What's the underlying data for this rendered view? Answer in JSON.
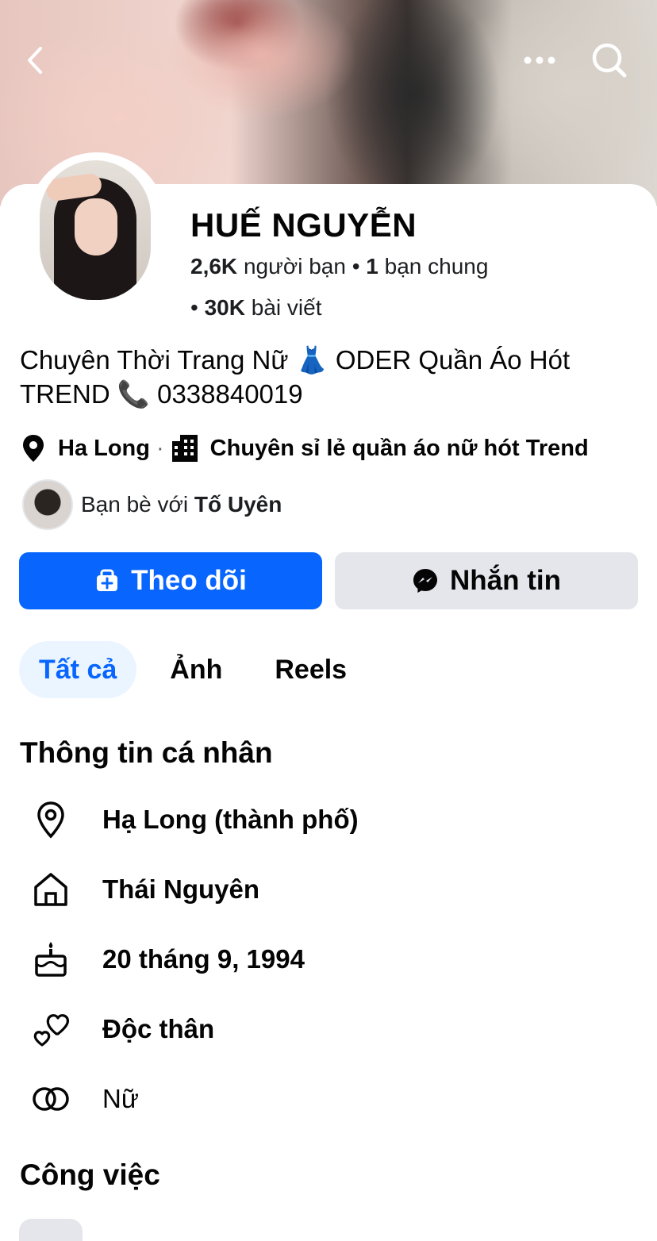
{
  "profile": {
    "name": "HUẾ NGUYỄN",
    "friends_count": "2,6K",
    "friends_label": "người bạn",
    "mutual_count": "1",
    "mutual_label": "bạn chung",
    "posts_count": "30K",
    "posts_label": "bài viết",
    "bio": "Chuyên Thời Trang Nữ 👗 ODER Quần Áo Hót TREND 📞 0338840019",
    "location": "Ha Long",
    "business": "Chuyên sỉ lẻ quần áo nữ hót Trend",
    "friends_with_prefix": "Bạn bè với",
    "friends_with_name": "Tố Uyên"
  },
  "actions": {
    "follow_label": "Theo dõi",
    "message_label": "Nhắn tin"
  },
  "tabs": [
    {
      "label": "Tất cả",
      "active": true
    },
    {
      "label": "Ảnh",
      "active": false
    },
    {
      "label": "Reels",
      "active": false
    }
  ],
  "personal_info": {
    "title": "Thông tin cá nhân",
    "items": [
      {
        "icon": "location-pin-icon",
        "text": "Hạ Long (thành phố)"
      },
      {
        "icon": "home-icon",
        "text": "Thái Nguyên"
      },
      {
        "icon": "birthday-cake-icon",
        "text": "20 tháng 9, 1994"
      },
      {
        "icon": "relationship-hearts-icon",
        "text": "Độc thân"
      },
      {
        "icon": "gender-icon",
        "text": "Nữ"
      }
    ]
  },
  "work": {
    "title": "Công việc"
  },
  "colors": {
    "accent": "#0866ff",
    "secondary_button": "#e4e6eb",
    "active_tab_bg": "#ebf5ff"
  }
}
